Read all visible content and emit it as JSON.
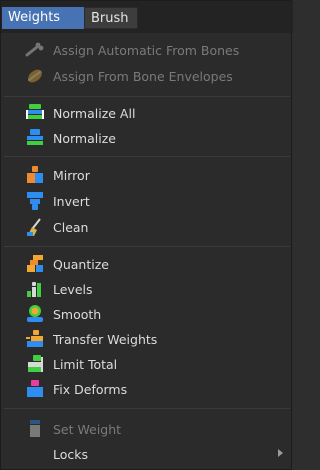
{
  "tabs": {
    "weights": "Weights",
    "brush": "Brush"
  },
  "items": {
    "assign_auto": "Assign Automatic From Bones",
    "assign_env": "Assign From Bone Envelopes",
    "normalize_all": "Normalize All",
    "normalize": "Normalize",
    "mirror": "Mirror",
    "invert": "Invert",
    "clean": "Clean",
    "quantize": "Quantize",
    "levels": "Levels",
    "smooth": "Smooth",
    "transfer": "Transfer Weights",
    "limit_total": "Limit Total",
    "fix_deforms": "Fix Deforms",
    "set_weight": "Set Weight",
    "locks": "Locks"
  },
  "icons": {
    "assign_auto": "bone-icon",
    "assign_env": "bone-envelope-icon",
    "normalize_all": "normalize-all-icon",
    "normalize": "normalize-icon",
    "mirror": "mirror-icon",
    "invert": "invert-icon",
    "clean": "clean-icon",
    "quantize": "quantize-icon",
    "levels": "levels-icon",
    "smooth": "smooth-icon",
    "transfer": "transfer-weights-icon",
    "limit_total": "limit-total-icon",
    "fix_deforms": "fix-deforms-icon",
    "set_weight": "set-weight-icon"
  },
  "colors": {
    "accent": "#4772b3",
    "menu_bg": "#2b2b2b",
    "text": "#dcdcdc",
    "disabled_text": "#7a7a7a"
  }
}
